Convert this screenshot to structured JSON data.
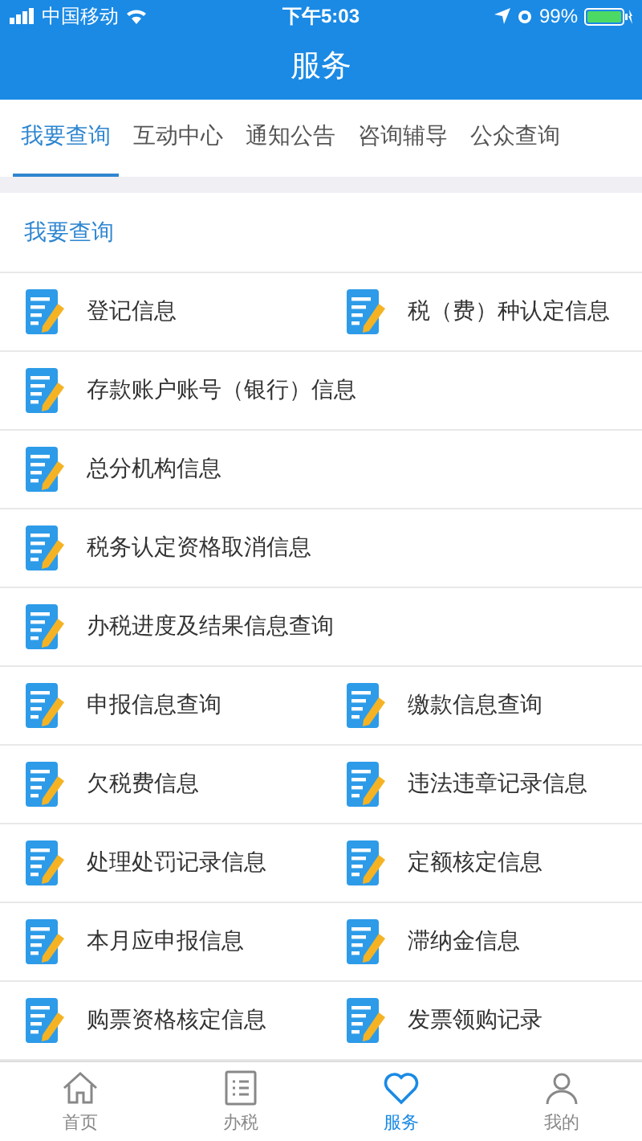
{
  "status_bar": {
    "carrier": "中国移动",
    "time": "下午5:03",
    "battery": "99%"
  },
  "header": {
    "title": "服务"
  },
  "tabs": [
    {
      "label": "我要查询",
      "selected": true
    },
    {
      "label": "互动中心",
      "selected": false
    },
    {
      "label": "通知公告",
      "selected": false
    },
    {
      "label": "咨询辅导",
      "selected": false
    },
    {
      "label": "公众查询",
      "selected": false
    }
  ],
  "section": {
    "title": "我要查询"
  },
  "rows": [
    [
      "登记信息",
      "税（费）种认定信息"
    ],
    [
      "存款账户账号（银行）信息"
    ],
    [
      "总分机构信息"
    ],
    [
      "税务认定资格取消信息"
    ],
    [
      "办税进度及结果信息查询"
    ],
    [
      "申报信息查询",
      "缴款信息查询"
    ],
    [
      "欠税费信息",
      "违法违章记录信息"
    ],
    [
      "处理处罚记录信息",
      "定额核定信息"
    ],
    [
      "本月应申报信息",
      "滞纳金信息"
    ],
    [
      "购票资格核定信息",
      "发票领购记录"
    ]
  ],
  "tab_bar": [
    {
      "label": "首页",
      "kind": "home",
      "selected": false
    },
    {
      "label": "办税",
      "kind": "list",
      "selected": false
    },
    {
      "label": "服务",
      "kind": "heart",
      "selected": true
    },
    {
      "label": "我的",
      "kind": "person",
      "selected": false
    }
  ]
}
